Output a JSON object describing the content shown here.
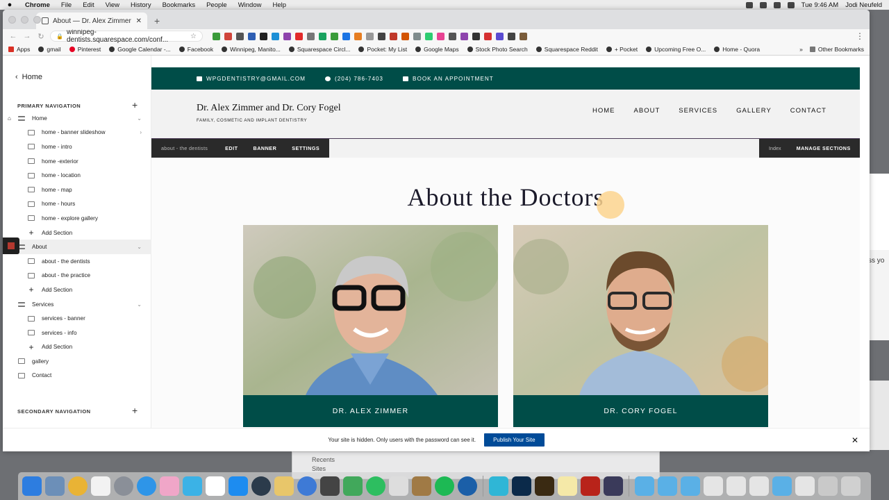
{
  "menubar": {
    "app": "Chrome",
    "items": [
      "File",
      "Edit",
      "View",
      "History",
      "Bookmarks",
      "People",
      "Window",
      "Help"
    ],
    "clock": "Tue 9:46 AM",
    "user": "Jodi Neufeld"
  },
  "browser": {
    "tab_title": "About — Dr. Alex Zimmer and",
    "url": "winnipeg-dentists.squarespace.com/conf...",
    "bookmarks": [
      "Apps",
      "gmail",
      "Pinterest",
      "Google Calendar -...",
      "Facebook",
      "Winnipeg, Manito...",
      "Squarespace Circl...",
      "Pocket: My List",
      "Google Maps",
      "Stock Photo Search",
      "Squarespace Reddit",
      "+ Pocket",
      "Upcoming Free O...",
      "Home - Quora"
    ],
    "bookmarks_more": "»",
    "other_bookmarks": "Other Bookmarks",
    "stock_label": "Stock P"
  },
  "sidebar": {
    "back_label": "Home",
    "primary_heading": "PRIMARY NAVIGATION",
    "secondary_heading": "SECONDARY NAVIGATION",
    "items": [
      {
        "label": "Home",
        "level": 0,
        "type": "folder",
        "home": true,
        "chevron": "⌄"
      },
      {
        "label": "home - banner slideshow",
        "level": 1,
        "type": "gallery",
        "chevron": "›"
      },
      {
        "label": "home - intro",
        "level": 1,
        "type": "page"
      },
      {
        "label": "home -exterior",
        "level": 1,
        "type": "page"
      },
      {
        "label": "home - location",
        "level": 1,
        "type": "page"
      },
      {
        "label": "home - map",
        "level": 1,
        "type": "page"
      },
      {
        "label": "home - hours",
        "level": 1,
        "type": "page"
      },
      {
        "label": "home - explore gallery",
        "level": 1,
        "type": "page"
      },
      {
        "label": "Add Section",
        "level": 1,
        "type": "add"
      },
      {
        "label": "About",
        "level": 0,
        "type": "folder",
        "selected": true,
        "chevron": "⌄"
      },
      {
        "label": "about - the dentists",
        "level": 1,
        "type": "page"
      },
      {
        "label": "about - the practice",
        "level": 1,
        "type": "page"
      },
      {
        "label": "Add Section",
        "level": 1,
        "type": "add"
      },
      {
        "label": "Services",
        "level": 0,
        "type": "folder",
        "chevron": "⌄"
      },
      {
        "label": "services - banner",
        "level": 1,
        "type": "page"
      },
      {
        "label": "services - info",
        "level": 1,
        "type": "page"
      },
      {
        "label": "Add Section",
        "level": 1,
        "type": "add"
      },
      {
        "label": "gallery",
        "level": 0,
        "type": "page"
      },
      {
        "label": "Contact",
        "level": 0,
        "type": "page"
      }
    ]
  },
  "site": {
    "email": "WPGDENTISTRY@GMAIL.COM",
    "phone": "(204) 786-7403",
    "book": "BOOK AN APPOINTMENT",
    "brand": "Dr. Alex Zimmer and Dr. Cory Fogel",
    "tagline": "FAMILY, COSMETIC AND IMPLANT DENTISTRY",
    "nav": [
      "HOME",
      "ABOUT",
      "SERVICES",
      "GALLERY",
      "CONTACT"
    ],
    "editbar": {
      "crumb": "about - the dentists",
      "edit": "EDIT",
      "banner": "BANNER",
      "settings": "SETTINGS",
      "index": "Index",
      "manage": "MANAGE SECTIONS"
    },
    "heading": "About the Doctors",
    "doctors": [
      {
        "name": "DR. ALEX ZIMMER"
      },
      {
        "name": "DR. CORY FOGEL"
      }
    ]
  },
  "notice": {
    "text": "Your site is hidden. Only users with the password can see it.",
    "button": "Publish Your Site"
  },
  "desktop": {
    "finder_rows": [
      "Recents",
      "Sites"
    ],
    "right_text": "ss yo"
  },
  "colors": {
    "brand_green": "#004d48",
    "publish_blue": "#004b98",
    "accent_yellow": "#fcd38e"
  }
}
